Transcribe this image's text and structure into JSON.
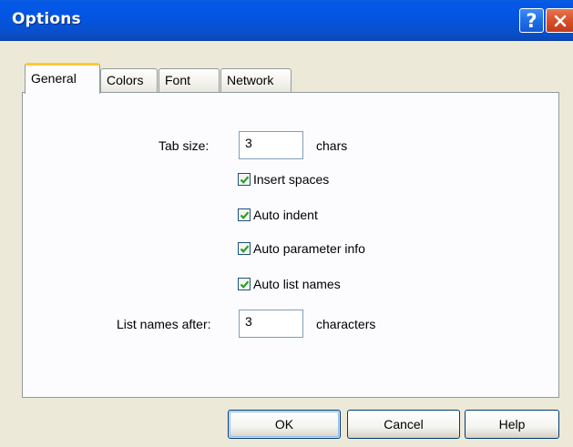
{
  "window": {
    "title": "Options",
    "help_glyph": "?",
    "close_glyph": "✕"
  },
  "tabs": [
    {
      "label": "General",
      "active": true
    },
    {
      "label": "Colors",
      "active": false
    },
    {
      "label": "Font",
      "active": false
    },
    {
      "label": "Network",
      "active": false
    }
  ],
  "general": {
    "tab_size_label": "Tab size:",
    "tab_size_value": "3",
    "tab_size_unit": "chars",
    "checkboxes": [
      {
        "label": "Insert spaces",
        "checked": true
      },
      {
        "label": "Auto indent",
        "checked": true
      },
      {
        "label": "Auto parameter info",
        "checked": true
      },
      {
        "label": "Auto list names",
        "checked": true
      }
    ],
    "list_names_label": "List names after:",
    "list_names_value": "3",
    "list_names_unit": "characters"
  },
  "buttons": {
    "ok": "OK",
    "cancel": "Cancel",
    "help": "Help"
  },
  "colors": {
    "titlebar": "#0355e3",
    "check_mark": "#21a121",
    "active_tab_highlight": "#ffc83c",
    "dialog_bg": "#ece9d8"
  },
  "icons": {
    "help": "question-mark-icon",
    "close": "close-x-icon",
    "check": "checkmark-icon"
  }
}
